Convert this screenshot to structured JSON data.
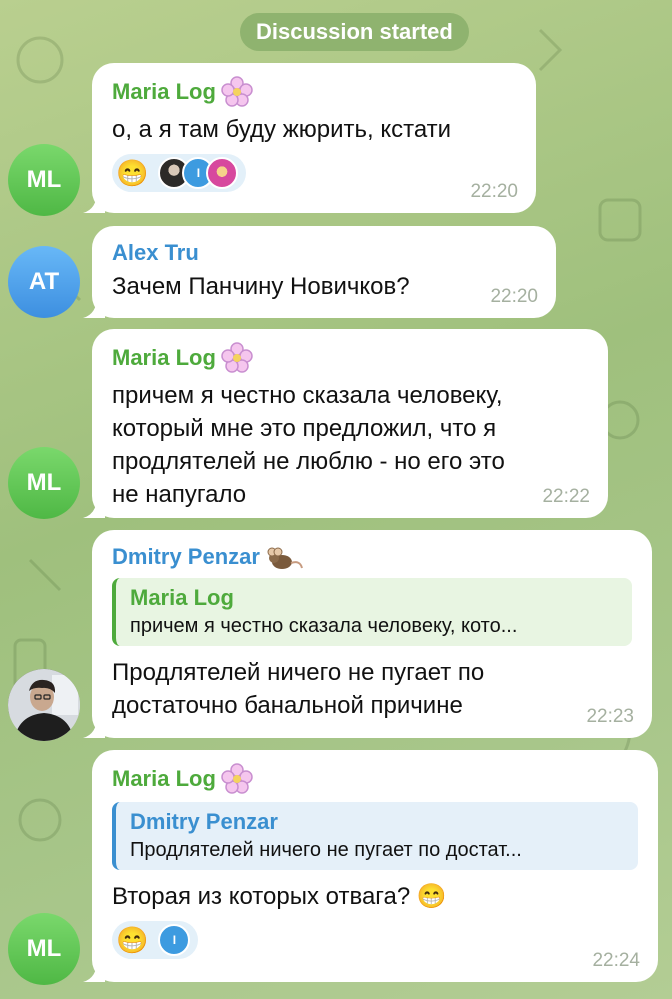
{
  "service_message": "Discussion started",
  "messages": [
    {
      "sender": "Maria Log",
      "avatar": "ML",
      "text": "о, а я там буду жюрить, кстати",
      "time": "22:20",
      "reactions": {
        "emoji": "😁",
        "voter_badge": "I"
      }
    },
    {
      "sender": "Alex Tru",
      "avatar": "AT",
      "text": "Зачем Панчину Новичков?",
      "time": "22:20"
    },
    {
      "sender": "Maria Log",
      "avatar": "ML",
      "text_lines": [
        "причем я честно сказала человеку,",
        "который мне это предложил, что я",
        "продлятелей не люблю - но его это",
        "не напугало"
      ],
      "time": "22:22"
    },
    {
      "sender": "Dmitry Penzar",
      "avatar": "photo",
      "reply": {
        "name": "Maria Log",
        "text": "причем я честно сказала человеку, кото..."
      },
      "text_lines": [
        "Продлятелей ничего не пугает по",
        "достаточно банальной причине"
      ],
      "time": "22:23"
    },
    {
      "sender": "Maria Log",
      "avatar": "ML",
      "reply": {
        "name": "Dmitry Penzar",
        "text": "Продлятелей ничего не пугает по достат..."
      },
      "text": "Вторая из которых отвага? 😁",
      "time": "22:24",
      "reactions": {
        "emoji": "😁",
        "voter_badge": "I"
      }
    }
  ],
  "colors": {
    "sender_green": "#4eaa3c",
    "sender_blue": "#3a8fd0",
    "avatar_green": "#5cc24f",
    "avatar_blue": "#4a9ee8"
  }
}
